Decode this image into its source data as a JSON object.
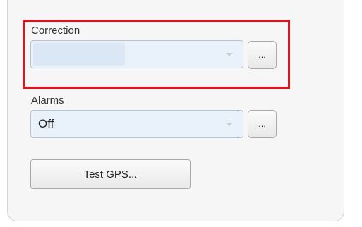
{
  "correction": {
    "label": "Correction",
    "value": "",
    "more_button_label": "..."
  },
  "alarms": {
    "label": "Alarms",
    "value": "Off",
    "more_button_label": "..."
  },
  "test_gps": {
    "label": "Test GPS..."
  },
  "colors": {
    "highlight": "#e0131c",
    "select_background": "#e9f1fa",
    "panel_background": "#f6f6f6"
  },
  "icons": {
    "dropdown": "chevron-down-icon"
  }
}
